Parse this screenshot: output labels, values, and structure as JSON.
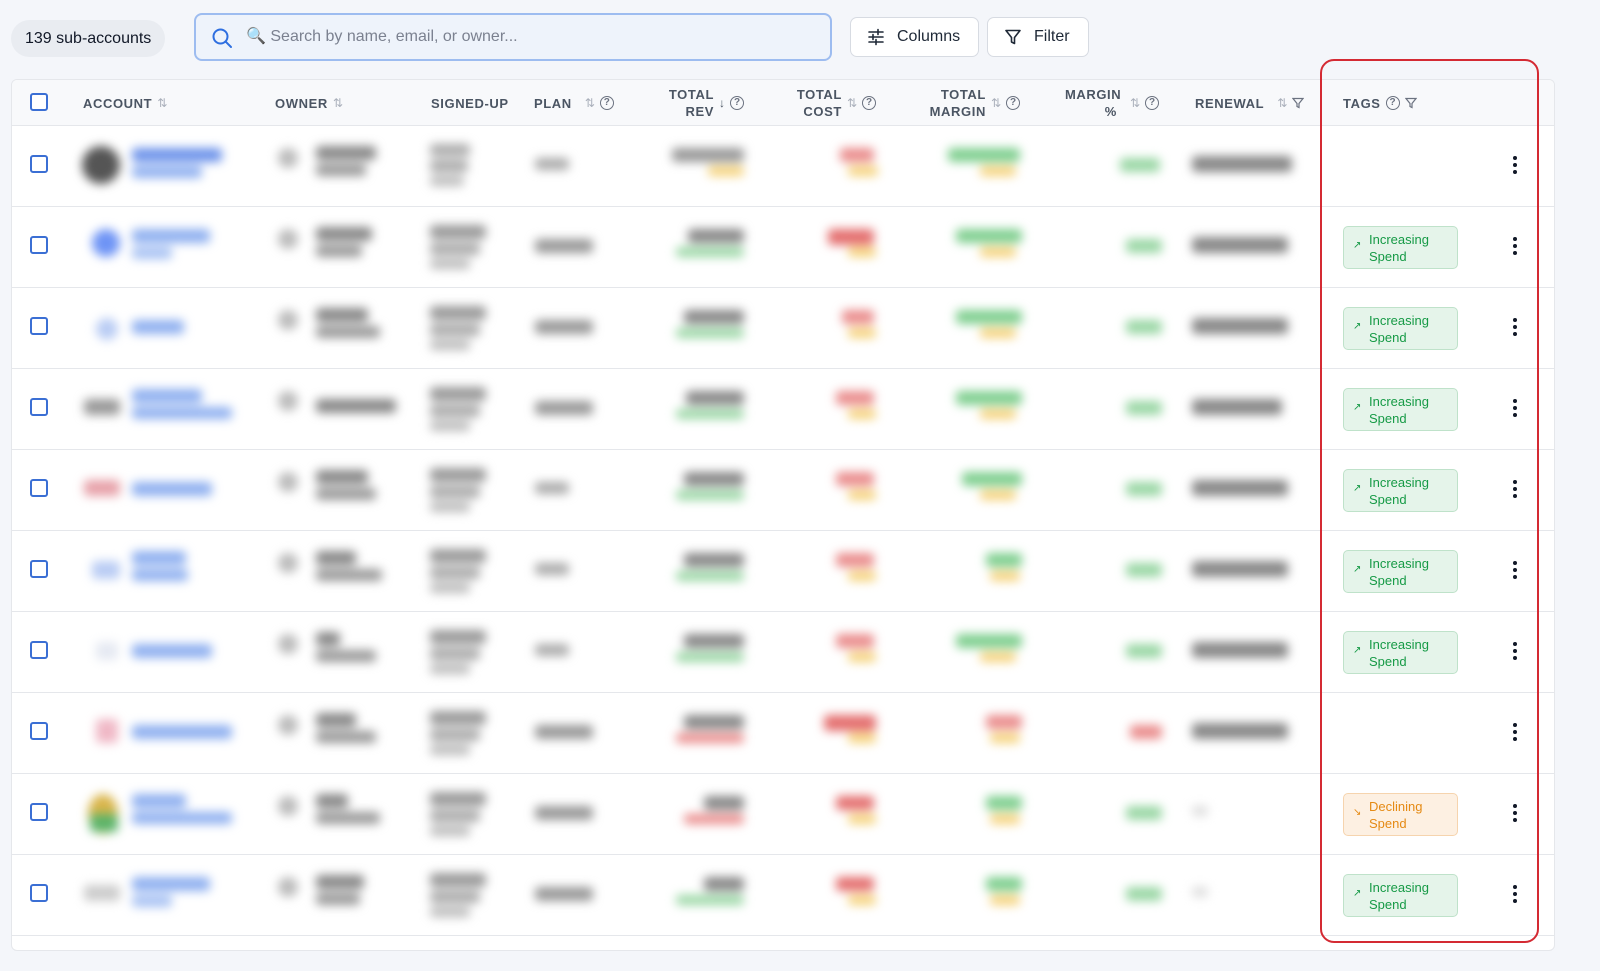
{
  "toolbar": {
    "account_count": "139 sub-accounts",
    "search_placeholder": "🔍 Search by name, email, or owner...",
    "columns_label": "Columns",
    "filter_label": "Filter"
  },
  "table": {
    "columns": {
      "account": "ACCOUNT",
      "owner": "OWNER",
      "signed_up": "SIGNED-UP",
      "plan": "PLAN",
      "total_rev": "TOTAL REV",
      "total_cost": "TOTAL COST",
      "total_margin": "TOTAL MARGIN",
      "margin_pct": "MARGIN %",
      "renewal": "RENEWAL",
      "tags": "TAGS"
    },
    "rows": [
      {
        "tag": ""
      },
      {
        "tag": "Increasing Spend",
        "tag_type": "increasing"
      },
      {
        "tag": "Increasing Spend",
        "tag_type": "increasing"
      },
      {
        "tag": "Increasing Spend",
        "tag_type": "increasing"
      },
      {
        "tag": "Increasing Spend",
        "tag_type": "increasing"
      },
      {
        "tag": "Increasing Spend",
        "tag_type": "increasing"
      },
      {
        "tag": "Increasing Spend",
        "tag_type": "increasing"
      },
      {
        "tag": ""
      },
      {
        "tag": "Declining Spend",
        "tag_type": "declining"
      },
      {
        "tag": "Increasing Spend",
        "tag_type": "increasing"
      }
    ]
  },
  "colors": {
    "accent": "#3b6fd4",
    "increasing": "#169a46",
    "declining": "#e58a14",
    "highlight": "#d42a33"
  }
}
